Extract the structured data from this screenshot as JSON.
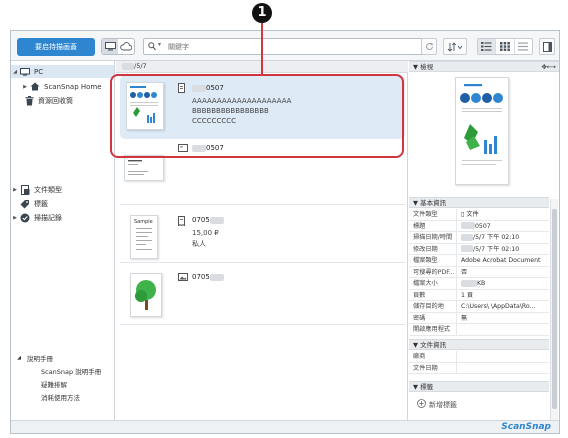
{
  "callout": "1",
  "toolbar": {
    "scan_button": "要启持描画蓋",
    "search_placeholder": "關鍵字"
  },
  "sidebar": {
    "pc": "PC",
    "scansnap_home": "ScanSnap Home",
    "recycle": "資源回收筒",
    "doc_type": "文件類型",
    "tags": "標籤",
    "scan_history": "掃描記錄"
  },
  "help": {
    "header": "說明手冊",
    "items": [
      "ScanSnap 說明手冊",
      "疑難排解",
      "消耗使用方法"
    ]
  },
  "center": {
    "path": "/5/7",
    "items": [
      {
        "name": "0507",
        "lines": [
          "AAAAAAAAAAAAAAAAAAAA",
          "BBBBBBBBBBBBBBBB",
          "CCCCCCCCC"
        ]
      },
      {
        "name": "0507",
        "lines": []
      },
      {
        "name": "0705",
        "lines": [
          "15,00 ₽",
          "私人"
        ]
      },
      {
        "name": "0705",
        "lines": []
      }
    ]
  },
  "right": {
    "preview_header": "▼  檢視",
    "basic_header": "▼  基本資訊",
    "doc_info_header": "▼  文件資訊",
    "tags_header": "▼  標籤",
    "add_tag": "新增標籤",
    "properties": [
      {
        "k": "文件類型",
        "v": "文件"
      },
      {
        "k": "標題",
        "v": "0507"
      },
      {
        "k": "掃描日期/時間",
        "v": "/5/7 下午 02:10"
      },
      {
        "k": "修改日期",
        "v": "/5/7 下午 02:10"
      },
      {
        "k": "檔案類型",
        "v": "Adobe Acrobat Document"
      },
      {
        "k": "可搜尋的PDF...",
        "v": "否"
      },
      {
        "k": "檔案大小",
        "v": "KB"
      },
      {
        "k": "頁數",
        "v": "1 頁"
      },
      {
        "k": "儲存目的地",
        "v": "C:\\Users\\   \\AppData\\Ro..."
      },
      {
        "k": "密碼",
        "v": "無"
      },
      {
        "k": "開啟應用程式",
        "v": ""
      }
    ],
    "doc_props": [
      {
        "k": "廠商",
        "v": ""
      },
      {
        "k": "文件日期",
        "v": ""
      }
    ]
  },
  "brand": "ScanSnap",
  "colors": {
    "accent": "#2f86d0",
    "callout_red": "#d1353f"
  }
}
